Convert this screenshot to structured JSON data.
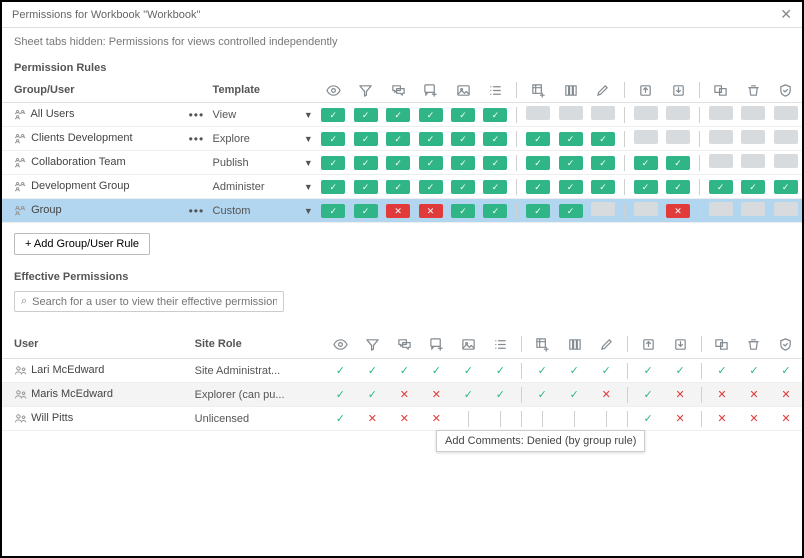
{
  "dialog": {
    "title": "Permissions for Workbook \"Workbook\"",
    "subheader": "Sheet tabs hidden: Permissions for views controlled independently"
  },
  "rules": {
    "title": "Permission Rules",
    "col_group": "Group/User",
    "col_template": "Template",
    "add_label": "Add Group/User Rule",
    "perm_icons": [
      "view",
      "filter",
      "comments",
      "add-comment",
      "image",
      "custom",
      "",
      "download",
      "overwrite",
      "edit",
      "",
      "share",
      "overwrite2",
      "",
      "move",
      "delete",
      "set-perm"
    ],
    "rows": [
      {
        "name": "All Users",
        "kebab": true,
        "template": "View",
        "chev": true,
        "perms": [
          "a",
          "a",
          "a",
          "a",
          "a",
          "a",
          "",
          "u",
          "u",
          "u",
          "",
          "u",
          "u",
          "",
          "u",
          "u",
          "u"
        ],
        "selected": false
      },
      {
        "name": "Clients Development",
        "kebab": true,
        "template": "Explore",
        "chev": true,
        "perms": [
          "a",
          "a",
          "a",
          "a",
          "a",
          "a",
          "",
          "a",
          "a",
          "a",
          "",
          "u",
          "u",
          "",
          "u",
          "u",
          "u"
        ],
        "selected": false
      },
      {
        "name": "Collaboration Team",
        "kebab": false,
        "template": "Publish",
        "chev": true,
        "perms": [
          "a",
          "a",
          "a",
          "a",
          "a",
          "a",
          "",
          "a",
          "a",
          "a",
          "",
          "a",
          "a",
          "",
          "u",
          "u",
          "u"
        ],
        "selected": false
      },
      {
        "name": "Development Group",
        "kebab": false,
        "template": "Administer",
        "chev": true,
        "perms": [
          "a",
          "a",
          "a",
          "a",
          "a",
          "a",
          "",
          "a",
          "a",
          "a",
          "",
          "a",
          "a",
          "",
          "a",
          "a",
          "a"
        ],
        "selected": false
      },
      {
        "name": "Group",
        "kebab": true,
        "template": "Custom",
        "chev": true,
        "perms": [
          "a",
          "a",
          "d",
          "d",
          "a",
          "a",
          "",
          "a",
          "a",
          "u",
          "",
          "u",
          "d",
          "",
          "u",
          "u",
          "u"
        ],
        "selected": true
      }
    ]
  },
  "effective": {
    "title": "Effective Permissions",
    "search_placeholder": "Search for a user to view their effective permissions",
    "col_user": "User",
    "col_role": "Site Role",
    "tooltip": "Add Comments: Denied (by group rule)",
    "rows": [
      {
        "name": "Lari McEdward",
        "role": "Site Administrat...",
        "perms": [
          "a",
          "a",
          "a",
          "a",
          "a",
          "a",
          "",
          "a",
          "a",
          "a",
          "",
          "a",
          "a",
          "",
          "a",
          "a",
          "a"
        ],
        "hover": false
      },
      {
        "name": "Maris McEdward",
        "role": "Explorer (can pu...",
        "perms": [
          "a",
          "a",
          "d",
          "d",
          "a",
          "a",
          "",
          "a",
          "a",
          "d",
          "",
          "a",
          "d",
          "",
          "d",
          "d",
          "d"
        ],
        "hover": true
      },
      {
        "name": "Will Pitts",
        "role": "Unlicensed",
        "perms": [
          "a",
          "d",
          "d",
          "d",
          "",
          "",
          "",
          "",
          "",
          "",
          "",
          "a",
          "d",
          "",
          "d",
          "d",
          "d"
        ],
        "hover": false
      }
    ]
  }
}
